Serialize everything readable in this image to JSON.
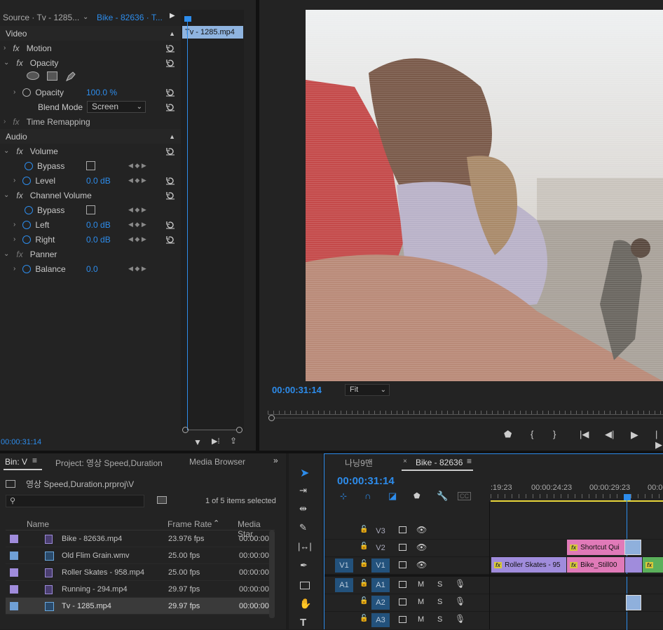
{
  "effect_controls": {
    "source_tab": "Source · Tv - 1285...",
    "sequence_tab": "Bike - 82636 · T...",
    "mini_clip": "Tv - 1285.mp4",
    "section_video": "Video",
    "motion": "Motion",
    "opacity": "Opacity",
    "opacity_param": "Opacity",
    "opacity_value": "100.0 %",
    "blend_mode_label": "Blend Mode",
    "blend_mode_value": "Screen",
    "time_remapping": "Time Remapping",
    "section_audio": "Audio",
    "volume": "Volume",
    "bypass": "Bypass",
    "level": "Level",
    "level_value": "0.0 dB",
    "channel_volume": "Channel Volume",
    "bypass2": "Bypass",
    "left": "Left",
    "left_value": "0.0 dB",
    "right": "Right",
    "right_value": "0.0 dB",
    "panner": "Panner",
    "balance": "Balance",
    "balance_value": "0.0",
    "timecode": "00:00:31:14",
    "fx_label": "fx"
  },
  "program": {
    "timecode": "00:00:31:14",
    "zoom": "Fit"
  },
  "project": {
    "tab_bin": "Bin: V",
    "tab_project": "Project: 영상 Speed,Duration",
    "tab_media": "Media Browser",
    "path": "영상 Speed,Duration.prproj\\V",
    "search_placeholder": "",
    "selection_info": "1 of 5 items selected",
    "col_name": "Name",
    "col_frame_rate": "Frame Rate",
    "col_media_start": "Media Star",
    "items": [
      {
        "name": "Bike - 82636.mp4",
        "fps": "23.976 fps",
        "start": "00:00:00",
        "color": "#a08cdc"
      },
      {
        "name": "Old Flim Grain.wmv",
        "fps": "25.00 fps",
        "start": "00:00:00",
        "color": "#6fa0d6"
      },
      {
        "name": "Roller Skates - 958.mp4",
        "fps": "25.00 fps",
        "start": "00:00:00",
        "color": "#a08cdc"
      },
      {
        "name": "Running - 294.mp4",
        "fps": "29.97 fps",
        "start": "00:00:00",
        "color": "#a08cdc"
      },
      {
        "name": "Tv - 1285.mp4",
        "fps": "29.97 fps",
        "start": "00:00:00",
        "color": "#6fa0d6"
      }
    ]
  },
  "timeline": {
    "tab1": "나닝9맨",
    "tab2": "Bike - 82636",
    "timecode": "00:00:31:14",
    "ruler": [
      ":19:23",
      "00:00:24:23",
      "00:00:29:23",
      "00:00"
    ],
    "tracks": {
      "v3": "V3",
      "v2": "V2",
      "v1": "V1",
      "v1src": "V1",
      "a1": "A1",
      "a1src": "A1",
      "a2": "A2",
      "a3": "A3",
      "m": "M",
      "s": "S"
    },
    "clips": {
      "shortcut": "Shortcut Qui",
      "roller": "Roller Skates - 95",
      "bike": "Bike_Still00"
    },
    "colors": {
      "purple": "#a08cdc",
      "pink": "#e07ab8",
      "green": "#5bb05b",
      "blue_clip": "#8fb0dc"
    }
  }
}
